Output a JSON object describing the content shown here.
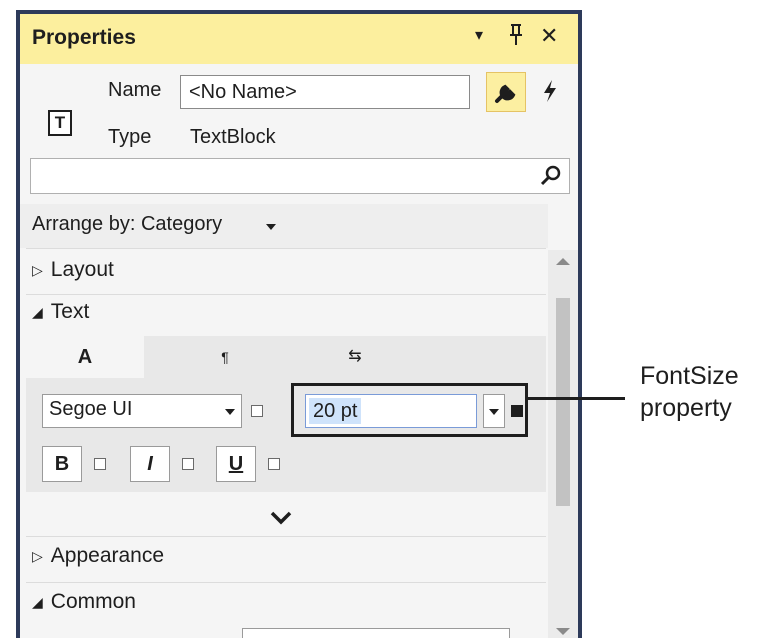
{
  "window": {
    "title": "Properties",
    "controls": {
      "dropdown": "▾",
      "pin": "ᵖ",
      "close": "✕"
    }
  },
  "header": {
    "type_icon_letter": "T",
    "name_label": "Name",
    "name_value": "<No Name>",
    "type_label": "Type",
    "type_value": "TextBlock",
    "tool_icons": [
      "wrench-icon",
      "lightning-icon"
    ]
  },
  "search": {
    "value": "",
    "icon": "search-icon"
  },
  "arrange": {
    "label": "Arrange by: Category"
  },
  "categories": {
    "layout": "Layout",
    "text": "Text",
    "appearance": "Appearance",
    "common": "Common"
  },
  "text_editor": {
    "tabs": [
      "A",
      "¶",
      "⇆"
    ],
    "font_family": "Segoe UI",
    "font_size": "20 pt",
    "style_buttons": [
      "B",
      "I",
      "U"
    ]
  },
  "annotation": {
    "line1": "FontSize",
    "line2": "property"
  },
  "colors": {
    "titlebar": "#fcef9e",
    "border": "#2d3a5a",
    "selection": "#cfe3fb"
  }
}
